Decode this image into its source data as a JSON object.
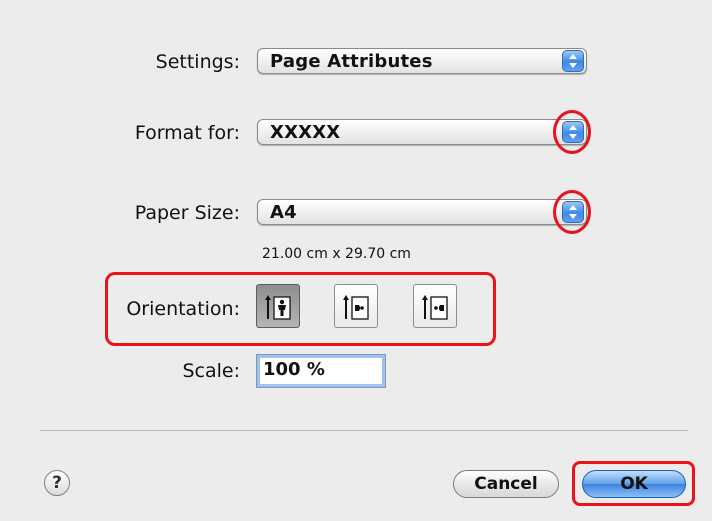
{
  "settings": {
    "label": "Settings:",
    "value": "Page Attributes"
  },
  "format_for": {
    "label": "Format for:",
    "value": "XXXXX"
  },
  "paper_size": {
    "label": "Paper Size:",
    "value": "A4",
    "dimensions": "21.00 cm x 29.70 cm"
  },
  "orientation": {
    "label": "Orientation:",
    "options": [
      {
        "icon": "portrait-orientation-icon",
        "selected": true
      },
      {
        "icon": "landscape-left-orientation-icon",
        "selected": false
      },
      {
        "icon": "landscape-right-orientation-icon",
        "selected": false
      }
    ]
  },
  "scale": {
    "label": "Scale:",
    "value": "100 %"
  },
  "buttons": {
    "help": "?",
    "cancel": "Cancel",
    "ok": "OK"
  },
  "colors": {
    "highlight": "#e8141a",
    "accent": "#3e8ae6"
  }
}
